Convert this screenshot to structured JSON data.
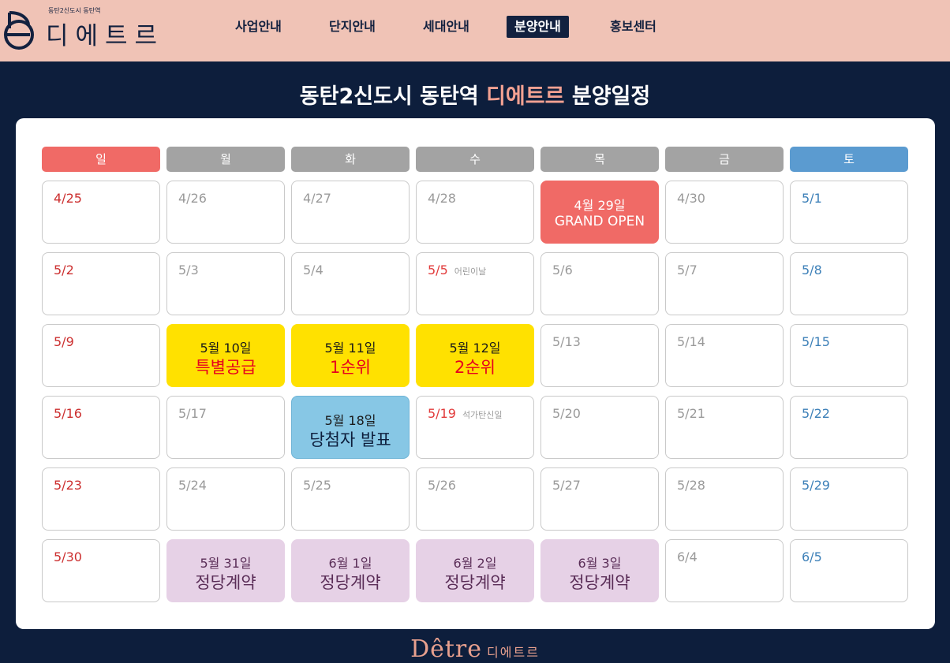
{
  "header": {
    "logo_small": "동탄2신도시 동탄역",
    "logo_big": "디에트르",
    "nav": [
      {
        "label": "사업안내",
        "active": false
      },
      {
        "label": "단지안내",
        "active": false
      },
      {
        "label": "세대안내",
        "active": false
      },
      {
        "label": "분양안내",
        "active": true
      },
      {
        "label": "홍보센터",
        "active": false
      }
    ]
  },
  "panel": {
    "title_prefix": "동탄2신도시 동탄역 ",
    "title_accent": "디에트르",
    "title_suffix": " 분양일정"
  },
  "calendar": {
    "days": [
      "일",
      "월",
      "화",
      "수",
      "목",
      "금",
      "토"
    ],
    "day_colors": [
      "#f06a66",
      "#a3a3a3",
      "#a3a3a3",
      "#a3a3a3",
      "#a3a3a3",
      "#a3a3a3",
      "#5b9bd0"
    ],
    "weeks": [
      [
        {
          "date": "4/25"
        },
        {
          "date": "4/26"
        },
        {
          "date": "4/27"
        },
        {
          "date": "4/28"
        },
        {
          "event": "red",
          "ev_date": "4월 29일",
          "ev_label": "GRAND OPEN"
        },
        {
          "date": "4/30"
        },
        {
          "date": "5/1"
        }
      ],
      [
        {
          "date": "5/2"
        },
        {
          "date": "5/3"
        },
        {
          "date": "5/4"
        },
        {
          "date": "5/5",
          "holiday": true,
          "note": "어린이날"
        },
        {
          "date": "5/6"
        },
        {
          "date": "5/7"
        },
        {
          "date": "5/8"
        }
      ],
      [
        {
          "date": "5/9"
        },
        {
          "event": "yellow",
          "ev_date": "5월 10일",
          "ev_label": "특별공급"
        },
        {
          "event": "yellow",
          "ev_date": "5월 11일",
          "ev_label": "1순위"
        },
        {
          "event": "yellow",
          "ev_date": "5월 12일",
          "ev_label": "2순위"
        },
        {
          "date": "5/13"
        },
        {
          "date": "5/14"
        },
        {
          "date": "5/15"
        }
      ],
      [
        {
          "date": "5/16"
        },
        {
          "date": "5/17"
        },
        {
          "event": "blue",
          "ev_date": "5월 18일",
          "ev_label": "당첨자 발표"
        },
        {
          "date": "5/19",
          "holiday": true,
          "note": "석가탄신일"
        },
        {
          "date": "5/20"
        },
        {
          "date": "5/21"
        },
        {
          "date": "5/22"
        }
      ],
      [
        {
          "date": "5/23"
        },
        {
          "date": "5/24"
        },
        {
          "date": "5/25"
        },
        {
          "date": "5/26"
        },
        {
          "date": "5/27"
        },
        {
          "date": "5/28"
        },
        {
          "date": "5/29"
        }
      ],
      [
        {
          "date": "5/30"
        },
        {
          "event": "purple",
          "ev_date": "5월 31일",
          "ev_label": "정당계약"
        },
        {
          "event": "purple",
          "ev_date": "6월 1일",
          "ev_label": "정당계약"
        },
        {
          "event": "purple",
          "ev_date": "6월 2일",
          "ev_label": "정당계약"
        },
        {
          "event": "purple",
          "ev_date": "6월 3일",
          "ev_label": "정당계약"
        },
        {
          "date": "6/4"
        },
        {
          "date": "6/5"
        }
      ]
    ]
  },
  "footer": {
    "logo_script": "Dêtre",
    "logo_kor": "디에트르"
  }
}
